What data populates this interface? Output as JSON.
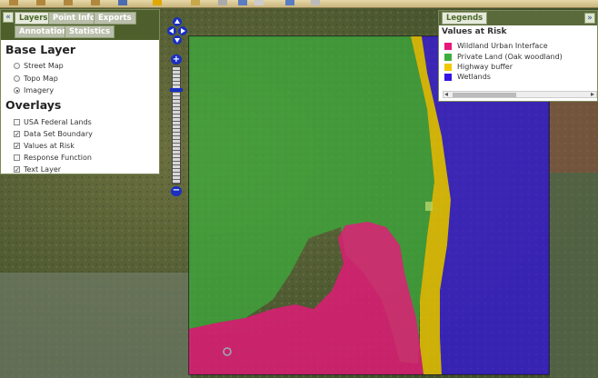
{
  "tabs": {
    "collapse": "«",
    "layers": "Layers",
    "point_info": "Point Info",
    "exports": "Exports",
    "annotation": "Annotation",
    "statistics": "Statistics"
  },
  "base_layer": {
    "heading": "Base Layer",
    "options": [
      {
        "label": "Street Map",
        "selected": false
      },
      {
        "label": "Topo Map",
        "selected": false
      },
      {
        "label": "Imagery",
        "selected": true
      }
    ]
  },
  "overlays": {
    "heading": "Overlays",
    "items": [
      {
        "label": "USA Federal Lands",
        "checked": false
      },
      {
        "label": "Data Set Boundary",
        "checked": true
      },
      {
        "label": "Values at Risk",
        "checked": true
      },
      {
        "label": "Response Function",
        "checked": false
      },
      {
        "label": "Text Layer",
        "checked": true
      }
    ]
  },
  "legend": {
    "tab_label": "Legends",
    "expand": "»",
    "title": "Values at Risk",
    "items": [
      {
        "label": "Wildland Urban Interface",
        "color": "#e8187a"
      },
      {
        "label": "Private Land (Oak woodland)",
        "color": "#3cae3c"
      },
      {
        "label": "Highway buffer",
        "color": "#f0c800"
      },
      {
        "label": "Wetlands",
        "color": "#3414e6"
      }
    ],
    "scroll_left": "◂",
    "scroll_right": "▸"
  },
  "zoom": {
    "in": "+",
    "out": "−"
  },
  "colors": {
    "wui": "#e8187a",
    "private": "#3cae3c",
    "highway": "#f0c800",
    "wetlands": "#3414e6",
    "panel_header": "#4f5f2c"
  }
}
